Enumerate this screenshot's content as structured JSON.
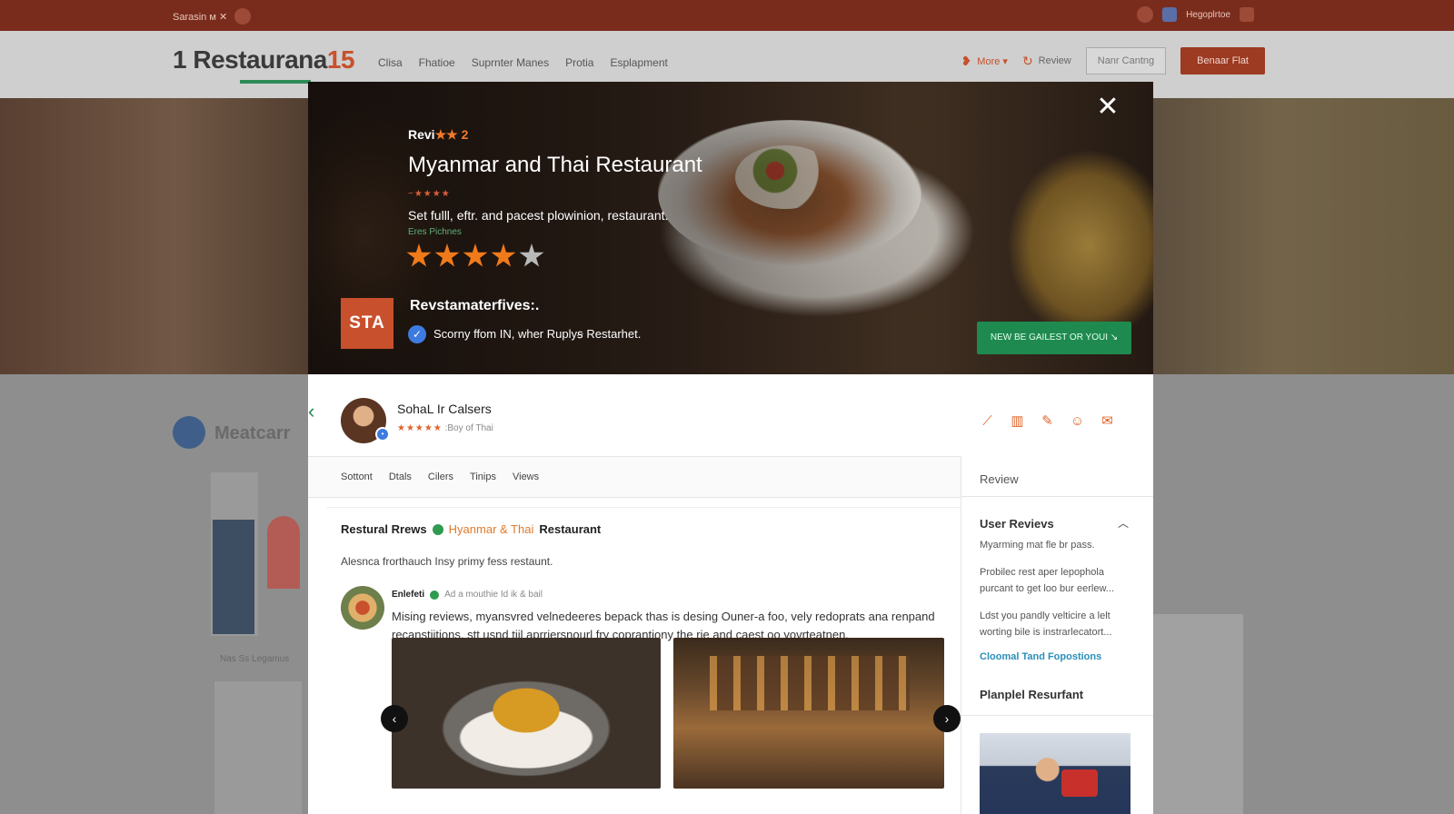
{
  "topbar": {
    "left_text": "Sarasin ᴍ ✕",
    "right_text": "Hegoplrtoe"
  },
  "navbar": {
    "brand": "1 Restaurana",
    "brand_accent": "15",
    "links": [
      "Clisa",
      "Fhatioe",
      "Suprnter Manes",
      "Protia",
      "Esplapment"
    ],
    "more_label": "More ▾",
    "review_label": "Review",
    "outline_button": "Nanr Cantng",
    "solid_button": "Benaar Flat"
  },
  "background": {
    "section_title": "Meatcarr",
    "small_text": "Nas Ss Legamus"
  },
  "modal": {
    "hero": {
      "eyebrow": "Revi",
      "eyebrow_accent": "★★ 2",
      "title": "Myanmar and Thai Restaurant",
      "mini_rating": "~★★★★",
      "subtitle": "Set fulll, eftr. and pacest plowinion, restaurant.",
      "small_link": "Eres Pichnes",
      "rating": 4,
      "rating_max": 5,
      "logo_text": "STA",
      "label": "Revstamaterfives:.",
      "verified_text": "Scorny ffom IN, wher Ruplyꞩ Restarhet.",
      "cta": "NEW BE GAILEST OR YOUI ↘"
    },
    "reviewer": {
      "name": "SohaL Ir Calsers",
      "stars": "★★★★★",
      "meta": ":Boy of Thai"
    },
    "tools": [
      "trend-icon",
      "bar-chart-icon",
      "edit-icon",
      "user-icon",
      "chat-icon"
    ],
    "tabs": [
      "Sottont",
      "Dtals",
      "Cilers",
      "Tinips",
      "Views"
    ],
    "side_header": "Review",
    "main": {
      "heading_start": "Restural Rrews",
      "heading_orange": "Hyanmar & Thai",
      "heading_end": "Restaurant",
      "description": "Alesnca frorthauch Insy primy fess restaunt.",
      "comment_author": "Enlefeti",
      "comment_meta": "Ad a mouthie Id ik & bail",
      "comment_body": "Mising reviews, myansvred velnedeeres bepack thas is desing Ouner-a foo, vely redoprats ana renpand recanstiitions. stt usnd tiil aprriersnourl fry coprantiony the rie and caest oo yovrteatnen."
    },
    "side": {
      "heading": "User Revievs",
      "p1": "Myarming mat fle br pass.",
      "p2": "Probilec rest aper lepophola purcant to get loo bur eerlew...",
      "p3": "Ldst you pandly velticire a lelt worting bile is instrarlecatort...",
      "link": "Cloomal Tand Fopostions",
      "subheading": "Planplel Resurfant"
    }
  }
}
